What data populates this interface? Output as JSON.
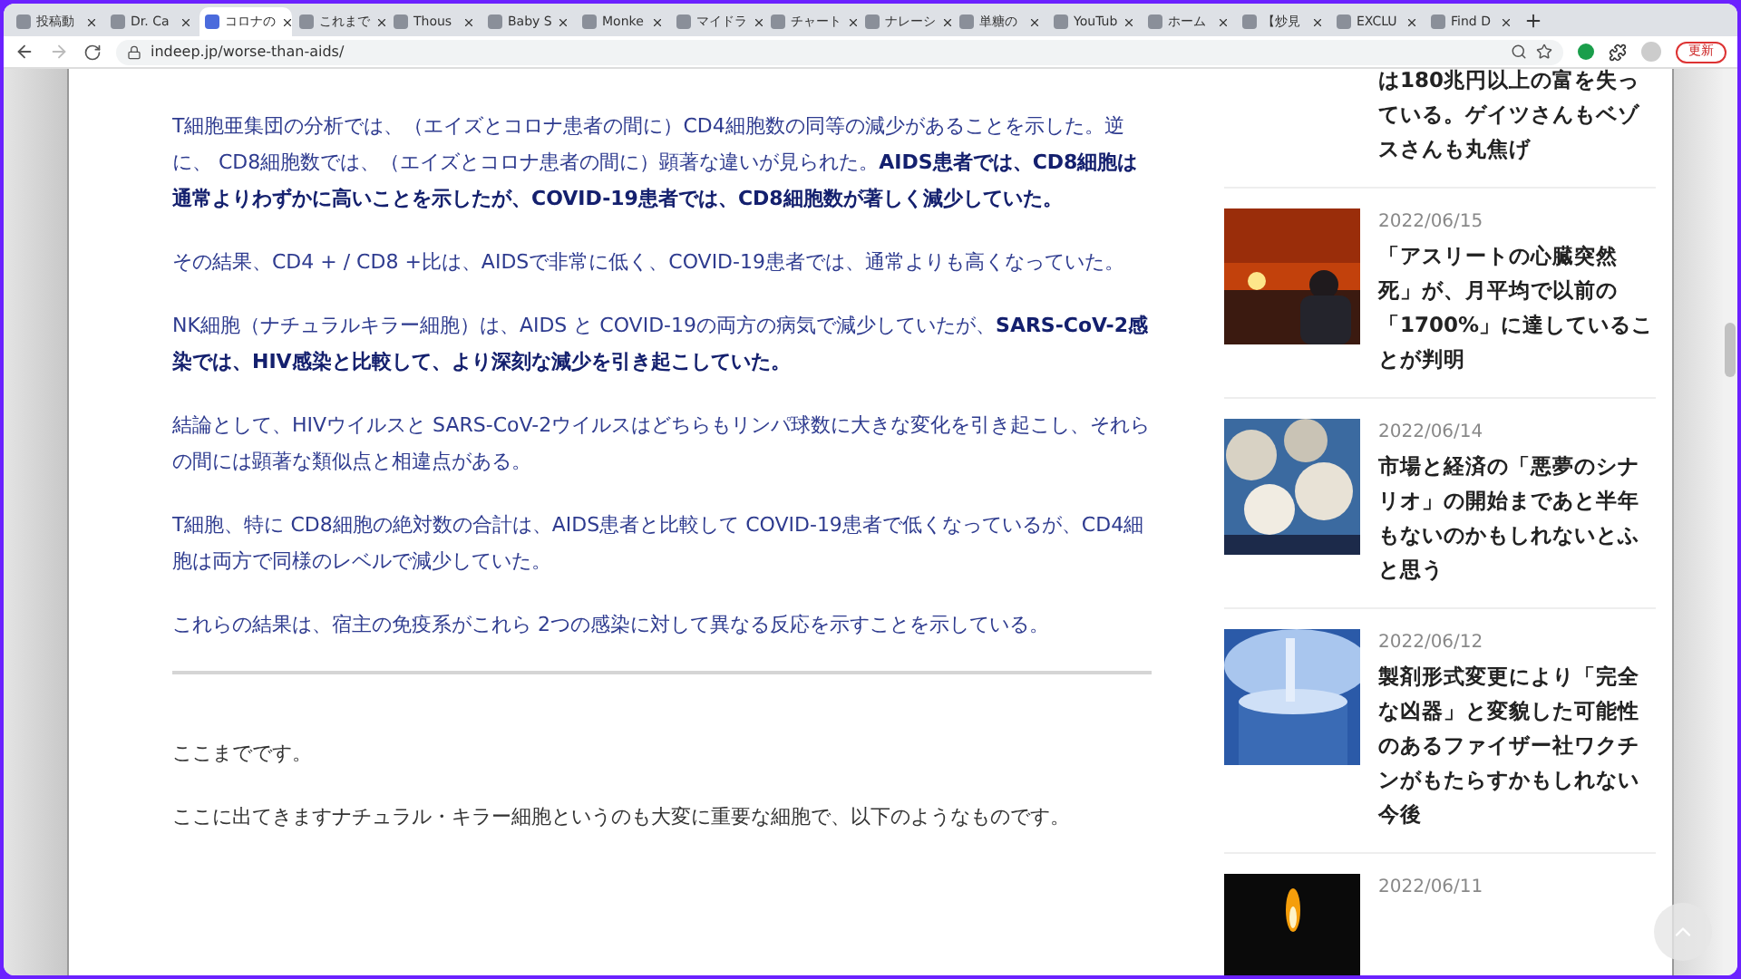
{
  "browser": {
    "tabs": [
      {
        "label": "投稿動",
        "selected": false
      },
      {
        "label": "Dr. Ca",
        "selected": false
      },
      {
        "label": "コロナの",
        "selected": true
      },
      {
        "label": "これまで",
        "selected": false
      },
      {
        "label": "Thous",
        "selected": false
      },
      {
        "label": "Baby S",
        "selected": false
      },
      {
        "label": "Monke",
        "selected": false
      },
      {
        "label": "マイドラ",
        "selected": false
      },
      {
        "label": "チャート",
        "selected": false
      },
      {
        "label": "ナレーシ",
        "selected": false
      },
      {
        "label": "単糖の",
        "selected": false
      },
      {
        "label": "YouTub",
        "selected": false
      },
      {
        "label": "ホーム",
        "selected": false
      },
      {
        "label": "【炒見",
        "selected": false
      },
      {
        "label": "EXCLU",
        "selected": false
      },
      {
        "label": "Find D",
        "selected": false
      }
    ],
    "url": "indeep.jp/worse-than-aids/",
    "update_button": "更新"
  },
  "article": {
    "paragraphs": [
      {
        "kind": "blue",
        "text": "T細胞亜集団の分析では、（エイズとコロナ患者の間に）CD4細胞数の同等の減少があることを示した。逆に、 CD8細胞数では、（エイズとコロナ患者の間に）顕著な違いが見られた。**AIDS患者では、CD8細胞は通常よりわずかに高いことを示したが、COVID-19患者では、CD8細胞数が著しく減少していた。**"
      },
      {
        "kind": "blue",
        "text": "その結果、CD4 + / CD8 +比は、AIDSで非常に低く、COVID-19患者では、通常よりも高くなっていた。"
      },
      {
        "kind": "blue",
        "text": "NK細胞（ナチュラルキラー細胞）は、AIDS と COVID-19の両方の病気で減少していたが、**SARS-CoV-2感染では、HIV感染と比較して、より深刻な減少を引き起こしていた。**"
      },
      {
        "kind": "blue",
        "text": "結論として、HIVウイルスと SARS-CoV-2ウイルスはどちらもリンパ球数に大きな変化を引き起こし、それらの間には顕著な類似点と相違点がある。"
      },
      {
        "kind": "blue",
        "text": "T細胞、特に CD8細胞の絶対数の合計は、AIDS患者と比較して COVID-19患者で低くなっているが、CD4細胞は両方で同様のレベルで減少していた。"
      },
      {
        "kind": "blue",
        "text": "これらの結果は、宿主の免疫系がこれら 2つの感染に対して異なる反応を示すことを示している。"
      },
      {
        "kind": "rule"
      },
      {
        "kind": "plain",
        "text": "ここまでです。"
      },
      {
        "kind": "plain",
        "text": "ここに出てきますナチュラル・キラー細胞というのも大変に重要な細胞で、以下のようなものです。"
      }
    ]
  },
  "sidebar": {
    "items": [
      {
        "title": "は180兆円以上の富を失っている。ゲイツさんもベゾスさんも丸焦げ"
      },
      {
        "date": "2022/06/15",
        "title": "「アスリートの心臓突然死」が、月平均で以前の「1700%」に達していることが判明",
        "kind": "picture"
      },
      {
        "date": "2022/06/14",
        "title": "市場と経済の「悪夢のシナリオ」の開始まであと半年もないのかもしれないとふと思う",
        "kind": "picture"
      },
      {
        "date": "2022/06/12",
        "title": "製剤形式変更により「完全な凶器」と変貌した可能性のあるファイザー社ワクチンがもたらすかもしれない今後",
        "kind": "picture"
      },
      {
        "date": "2022/06/11",
        "kind": "picture"
      }
    ]
  }
}
